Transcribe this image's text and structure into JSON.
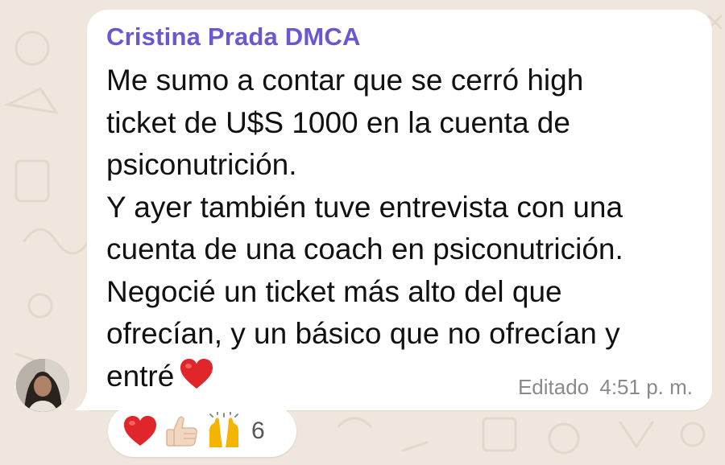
{
  "message": {
    "sender": "Cristina Prada DMCA",
    "lines": [
      "Me sumo a contar que se cerró high",
      "ticket de U$S 1000 en la cuenta de",
      "psiconutrición.",
      "Y ayer también tuve entrevista con una",
      "cuenta de una coach en psiconutrición.",
      "Negocié un ticket más alto del que",
      "ofrecían, y un básico que no ofrecían y",
      "entré"
    ],
    "inline_emoji": "heart-icon",
    "edited_label": "Editado",
    "time": "4:51 p. m."
  },
  "reactions": {
    "emojis": [
      "heart-icon",
      "thumbs-up-icon",
      "raised-hands-icon"
    ],
    "count": "6"
  },
  "colors": {
    "sender": "#6e56cf",
    "background": "#efe7dd",
    "bubble": "#ffffff",
    "heart": "#e0252b"
  }
}
